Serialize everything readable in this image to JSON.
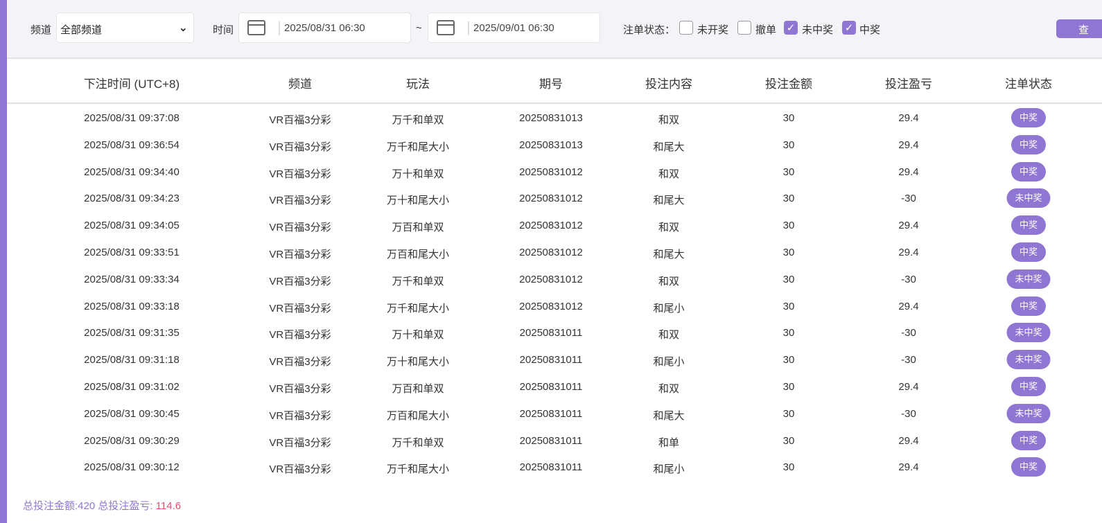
{
  "filter": {
    "channel_label": "频道",
    "channel_value": "全部频道",
    "time_label": "时间",
    "date_from": "2025/08/31 06:30",
    "range_sep": "~",
    "date_to": "2025/09/01 06:30",
    "status_label": "注单状态：",
    "statuses": [
      {
        "label": "未开奖",
        "checked": false
      },
      {
        "label": "撤单",
        "checked": false
      },
      {
        "label": "未中奖",
        "checked": true
      },
      {
        "label": "中奖",
        "checked": true
      }
    ],
    "query_button": "查"
  },
  "table": {
    "headers": [
      "下注时间 (UTC+8)",
      "频道",
      "玩法",
      "期号",
      "投注内容",
      "投注金额",
      "投注盈亏",
      "注单状态"
    ],
    "rows": [
      [
        "2025/08/31 09:37:08",
        "VR百福3分彩",
        "万千和单双",
        "20250831013",
        "和双",
        "30",
        "29.4",
        "中奖"
      ],
      [
        "2025/08/31 09:36:54",
        "VR百福3分彩",
        "万千和尾大小",
        "20250831013",
        "和尾大",
        "30",
        "29.4",
        "中奖"
      ],
      [
        "2025/08/31 09:34:40",
        "VR百福3分彩",
        "万十和单双",
        "20250831012",
        "和双",
        "30",
        "29.4",
        "中奖"
      ],
      [
        "2025/08/31 09:34:23",
        "VR百福3分彩",
        "万十和尾大小",
        "20250831012",
        "和尾大",
        "30",
        "-30",
        "未中奖"
      ],
      [
        "2025/08/31 09:34:05",
        "VR百福3分彩",
        "万百和单双",
        "20250831012",
        "和双",
        "30",
        "29.4",
        "中奖"
      ],
      [
        "2025/08/31 09:33:51",
        "VR百福3分彩",
        "万百和尾大小",
        "20250831012",
        "和尾大",
        "30",
        "29.4",
        "中奖"
      ],
      [
        "2025/08/31 09:33:34",
        "VR百福3分彩",
        "万千和单双",
        "20250831012",
        "和双",
        "30",
        "-30",
        "未中奖"
      ],
      [
        "2025/08/31 09:33:18",
        "VR百福3分彩",
        "万千和尾大小",
        "20250831012",
        "和尾小",
        "30",
        "29.4",
        "中奖"
      ],
      [
        "2025/08/31 09:31:35",
        "VR百福3分彩",
        "万十和单双",
        "20250831011",
        "和双",
        "30",
        "-30",
        "未中奖"
      ],
      [
        "2025/08/31 09:31:18",
        "VR百福3分彩",
        "万十和尾大小",
        "20250831011",
        "和尾小",
        "30",
        "-30",
        "未中奖"
      ],
      [
        "2025/08/31 09:31:02",
        "VR百福3分彩",
        "万百和单双",
        "20250831011",
        "和双",
        "30",
        "29.4",
        "中奖"
      ],
      [
        "2025/08/31 09:30:45",
        "VR百福3分彩",
        "万百和尾大小",
        "20250831011",
        "和尾大",
        "30",
        "-30",
        "未中奖"
      ],
      [
        "2025/08/31 09:30:29",
        "VR百福3分彩",
        "万千和单双",
        "20250831011",
        "和单",
        "30",
        "29.4",
        "中奖"
      ],
      [
        "2025/08/31 09:30:12",
        "VR百福3分彩",
        "万千和尾大小",
        "20250831011",
        "和尾小",
        "30",
        "29.4",
        "中奖"
      ]
    ]
  },
  "footer": {
    "total_bet_label": "总投注金额:420 总投注盈亏: ",
    "total_profit": "114.6"
  },
  "colors": {
    "accent": "#8f76d2",
    "profit": "#e0506e",
    "loss": "#2e9e7a"
  }
}
